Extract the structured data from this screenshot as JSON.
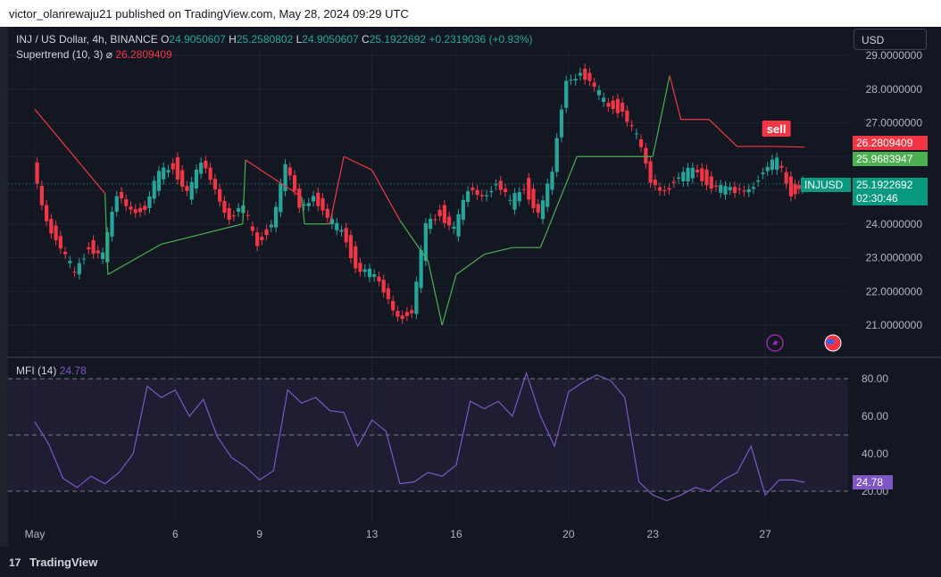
{
  "publish_line": "victor_olanrewaju21 published on TradingView.com, May 28, 2024 09:29 UTC",
  "legend": {
    "symbol": "INJ / US Dollar, 4h, BINANCE",
    "open_label": "O",
    "open": "24.9050607",
    "high_label": "H",
    "high": "25.2580802",
    "low_label": "L",
    "low": "24.9050607",
    "close_label": "C",
    "close": "25.1922692",
    "change": "+0.2319036 (+0.93%)",
    "supertrend_label": "Supertrend (10, 3)",
    "supertrend_symbol": "⌀",
    "supertrend_value": "26.2809409"
  },
  "currency_button": "USD",
  "price_boxes": {
    "supertrend": "26.2809409",
    "other": "25.9683947",
    "symbol_tag": "INJUSD",
    "last": "25.1922692",
    "countdown": "02:30:46",
    "mfi": "24.78"
  },
  "sell_label": "sell",
  "mfi": {
    "label": "MFI (14)",
    "value": "24.78"
  },
  "footer": "TradingView",
  "colors": {
    "up": "#26a69a",
    "down": "#f23645",
    "supertrend_up": "#4caf50",
    "supertrend_down": "#f23645",
    "mfi": "#7e57c2"
  },
  "icons": [
    "lightning-icon",
    "us-flag-icon",
    "tradingview-logo-icon"
  ],
  "chart_data": [
    {
      "type": "line",
      "title": "INJ / US Dollar, 4h, BINANCE",
      "y_ticks": [
        "29.0000000",
        "28.0000000",
        "27.0000000",
        "26.0000000",
        "25.0000000",
        "24.0000000",
        "23.0000000",
        "22.0000000",
        "21.0000000"
      ],
      "ylim": [
        20.5,
        29.2
      ],
      "x_ticks": [
        "May",
        "6",
        "9",
        "13",
        "16",
        "20",
        "23",
        "27"
      ],
      "x_tick_days": [
        1,
        6,
        9,
        13,
        16,
        20,
        23,
        27
      ],
      "xlim": [
        1,
        29
      ],
      "series": [
        {
          "name": "INJUSD",
          "x": [
            1,
            1.5,
            2,
            2.5,
            3,
            3.5,
            4,
            4.5,
            5,
            5.5,
            6,
            6.5,
            7,
            7.5,
            8,
            8.5,
            9,
            9.5,
            10,
            10.5,
            11,
            11.5,
            12,
            12.5,
            13,
            13.5,
            14,
            14.5,
            15,
            15.5,
            16,
            16.5,
            17,
            17.5,
            18,
            18.5,
            19,
            19.5,
            20,
            20.5,
            21,
            21.5,
            22,
            22.5,
            23,
            23.5,
            24,
            24.5,
            25,
            25.5,
            26,
            26.5,
            27,
            27.5,
            28,
            28.4
          ],
          "values": [
            25.8,
            24.2,
            23.1,
            22.6,
            23.4,
            23.0,
            24.8,
            24.6,
            24.3,
            25.5,
            25.8,
            24.9,
            25.7,
            25.2,
            24.1,
            24.4,
            23.5,
            24.0,
            25.6,
            24.6,
            24.9,
            24.0,
            23.9,
            22.8,
            22.5,
            22.0,
            21.4,
            21.2,
            24.0,
            24.4,
            23.8,
            24.9,
            25.0,
            25.1,
            24.6,
            25.2,
            24.3,
            25.4,
            28.4,
            28.5,
            27.9,
            27.6,
            27.4,
            26.5,
            25.3,
            25.1,
            25.2,
            25.7,
            25.3,
            25.0,
            24.9,
            25.2,
            25.4,
            25.9,
            25.0,
            25.19
          ]
        },
        {
          "name": "Supertrend (10, 3)",
          "x": [
            1,
            3.5,
            3.6,
            5.5,
            8.4,
            8.5,
            10.5,
            10.6,
            11.5,
            12,
            13,
            14,
            15,
            15.5,
            16,
            17,
            18,
            19,
            20.3,
            20.4,
            23,
            23.6,
            24,
            25,
            26,
            27.3,
            28.4
          ],
          "values": [
            27.4,
            24.9,
            22.5,
            23.4,
            24.0,
            25.9,
            24.8,
            24.0,
            24.0,
            26.0,
            25.6,
            24.1,
            22.9,
            21.0,
            22.5,
            23.1,
            23.3,
            23.3,
            26.0,
            26.0,
            26.0,
            28.4,
            27.1,
            27.1,
            26.3,
            26.3,
            26.28
          ]
        }
      ]
    },
    {
      "type": "line",
      "title": "MFI (14)",
      "y_ticks": [
        "80.00",
        "60.00",
        "40.00",
        "20.00"
      ],
      "ylim": [
        8,
        88
      ],
      "bands": [
        20,
        50,
        80
      ],
      "x": [
        1,
        1.5,
        2,
        2.5,
        3,
        3.5,
        4,
        4.5,
        5,
        5.5,
        6,
        6.5,
        7,
        7.5,
        8,
        8.5,
        9,
        9.5,
        10,
        10.5,
        11,
        11.5,
        12,
        12.5,
        13,
        13.5,
        14,
        14.5,
        15,
        15.5,
        16,
        16.5,
        17,
        17.5,
        18,
        18.5,
        19,
        19.5,
        20,
        20.5,
        21,
        21.5,
        22,
        22.5,
        23,
        23.5,
        24,
        24.5,
        25,
        25.5,
        26,
        26.5,
        27,
        27.5,
        28,
        28.4
      ],
      "values": [
        57,
        45,
        27,
        22,
        28,
        24,
        30,
        40,
        76,
        70,
        74,
        60,
        69,
        49,
        38,
        33,
        26,
        31,
        74,
        67,
        70,
        63,
        62,
        44,
        58,
        52,
        24,
        25,
        30,
        28,
        34,
        68,
        64,
        68,
        60,
        83,
        60,
        44,
        73,
        78,
        82,
        79,
        70,
        25,
        18,
        15,
        18,
        22,
        20,
        26,
        30,
        44,
        18,
        26,
        26,
        24.78
      ],
      "series": [
        {
          "name": "MFI (14)"
        }
      ]
    }
  ]
}
